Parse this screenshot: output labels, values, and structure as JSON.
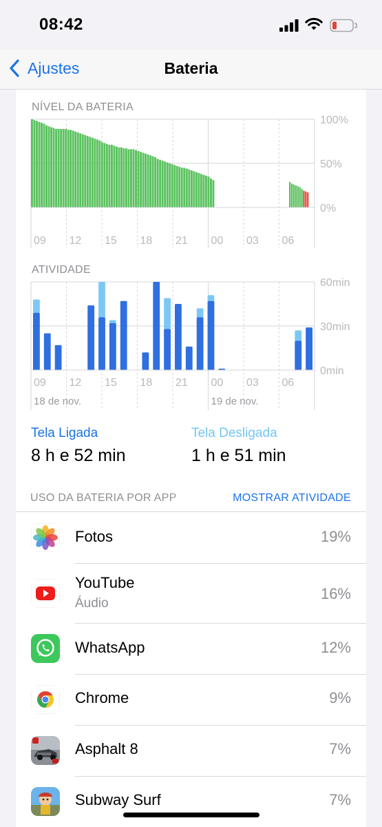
{
  "status_bar": {
    "time": "08:42",
    "battery_color": "#e0443e"
  },
  "nav": {
    "back_label": "Ajustes",
    "title": "Bateria"
  },
  "battery_level_chart": {
    "label": "NÍVEL DA BATERIA",
    "y_ticks": [
      "100%",
      "50%",
      "0%"
    ],
    "x_ticks": [
      "09",
      "12",
      "15",
      "18",
      "21",
      "00",
      "03",
      "06"
    ],
    "colors": {
      "normal": "#5ac15e",
      "low": "#e24a3d",
      "grid": "#d6d6da"
    }
  },
  "activity_chart": {
    "label": "ATIVIDADE",
    "y_ticks": [
      "60min",
      "30min",
      "0min"
    ],
    "x_ticks": [
      "09",
      "12",
      "15",
      "18",
      "21",
      "00",
      "03",
      "06"
    ],
    "dates": [
      "18 de nov.",
      "19 de nov."
    ],
    "colors": {
      "screen_on": "#2f6fe0",
      "screen_off": "#7cc8f5"
    }
  },
  "chart_data": [
    {
      "type": "bar",
      "title": "NÍVEL DA BATERIA",
      "ylim": [
        0,
        100
      ],
      "y_unit": "%",
      "x_ticks": [
        "09",
        "12",
        "15",
        "18",
        "21",
        "00",
        "03",
        "06"
      ],
      "series": [
        {
          "values": [
            100,
            99,
            98,
            97,
            96,
            95,
            93,
            92,
            91,
            90,
            89,
            89,
            89,
            89,
            89,
            88,
            88,
            87,
            86,
            85,
            84,
            83,
            82,
            81,
            80,
            79,
            78,
            77,
            76,
            74,
            73,
            72,
            71,
            71,
            70,
            69,
            68,
            68,
            67,
            67,
            66,
            66,
            66,
            65,
            64,
            63,
            62,
            61,
            60,
            59,
            58,
            57,
            55,
            54,
            53,
            52,
            51,
            50,
            49,
            48,
            47,
            46,
            45,
            45,
            44,
            43,
            42,
            41,
            40,
            39,
            38,
            37,
            36,
            35,
            33,
            31,
            29,
            29,
            28,
            28,
            28,
            28,
            28,
            28,
            28,
            28,
            28,
            28,
            28,
            28,
            28,
            28,
            28,
            28,
            28,
            28,
            28,
            28,
            28,
            28,
            28,
            28,
            28,
            28,
            28,
            28,
            28,
            28,
            28,
            28,
            28,
            28,
            28,
            28,
            28,
            28,
            28,
            28,
            28,
            28,
            28,
            28,
            28,
            28,
            28,
            28,
            28,
            28,
            28,
            28,
            28,
            28,
            28,
            28,
            28,
            28,
            28,
            28,
            28,
            28,
            28,
            28,
            28,
            28,
            28,
            28
          ]
        },
        {
          "values": [
            29,
            27,
            26,
            25,
            24,
            23,
            21,
            19,
            18,
            17
          ]
        }
      ]
    },
    {
      "type": "bar",
      "title": "ATIVIDADE",
      "ylim": [
        0,
        60
      ],
      "y_unit": "min",
      "x_ticks": [
        "09",
        "12",
        "15",
        "18",
        "21",
        "00",
        "03",
        "06"
      ],
      "series": [
        {
          "name": "Tela Ligada",
          "values": [
            39,
            25,
            17,
            0,
            0,
            44,
            36,
            32,
            47,
            0,
            12,
            60,
            28,
            45,
            16,
            36,
            47,
            1,
            0,
            0,
            0,
            0,
            0,
            0,
            20,
            29
          ]
        },
        {
          "name": "Tela Desligada",
          "values": [
            9,
            0,
            0,
            0,
            0,
            0,
            24,
            2,
            0,
            0,
            0,
            0,
            21,
            0,
            0,
            6,
            4,
            0,
            0,
            0,
            0,
            0,
            0,
            0,
            7,
            0
          ]
        }
      ]
    }
  ],
  "screen_time": {
    "on_label": "Tela Ligada",
    "on_value": "8 h e 52 min",
    "off_label": "Tela Desligada",
    "off_value": "1 h e 51 min"
  },
  "usage_section": {
    "title": "USO DA BATERIA POR APP",
    "action": "MOSTRAR ATIVIDADE"
  },
  "apps": [
    {
      "name": "Fotos",
      "sub": "",
      "pct": "19%",
      "icon": "photos-icon"
    },
    {
      "name": "YouTube",
      "sub": "Áudio",
      "pct": "16%",
      "icon": "youtube-icon"
    },
    {
      "name": "WhatsApp",
      "sub": "",
      "pct": "12%",
      "icon": "whatsapp-icon"
    },
    {
      "name": "Chrome",
      "sub": "",
      "pct": "9%",
      "icon": "chrome-icon"
    },
    {
      "name": "Asphalt 8",
      "sub": "",
      "pct": "7%",
      "icon": "asphalt-icon"
    },
    {
      "name": "Subway Surf",
      "sub": "",
      "pct": "7%",
      "icon": "subway-surf-icon"
    }
  ]
}
